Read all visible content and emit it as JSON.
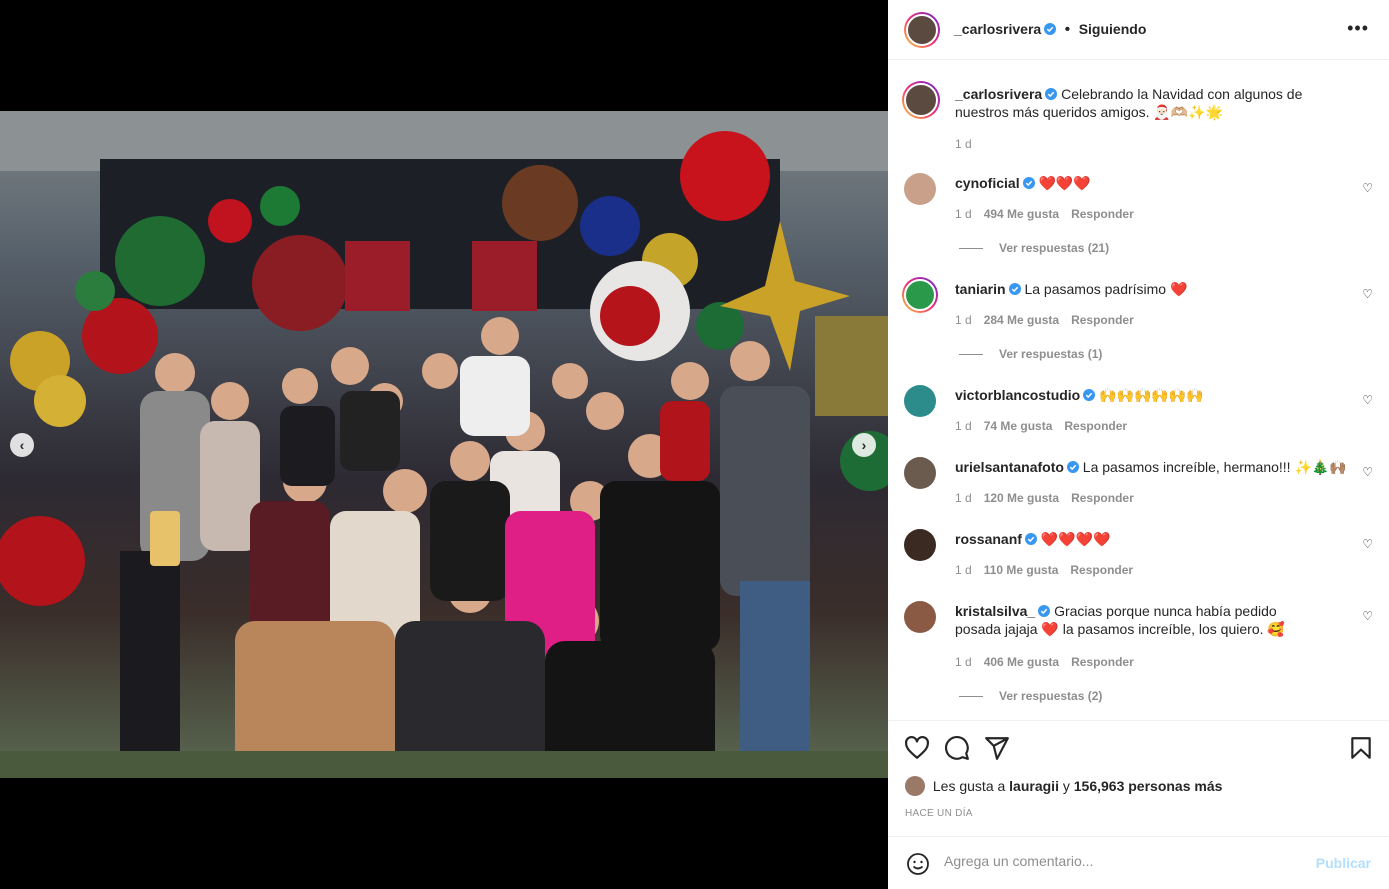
{
  "post": {
    "author": "_carlosrivera",
    "follow_status": "Siguiendo",
    "caption": "Celebrando la Navidad con algunos de nuestros más queridos amigos. 🎅🏻🫶🏼✨🌟",
    "caption_time": "1 d"
  },
  "comments": [
    {
      "user": "cynoficial",
      "text": "❤️❤️❤️",
      "time": "1 d",
      "likes": "494 Me gusta",
      "reply": "Responder",
      "view_replies": "Ver respuestas (21)"
    },
    {
      "user": "taniarin",
      "text": "La pasamos padrísimo ❤️",
      "time": "1 d",
      "likes": "284 Me gusta",
      "reply": "Responder",
      "view_replies": "Ver respuestas (1)"
    },
    {
      "user": "victorblancostudio",
      "text": "🙌🙌🙌🙌🙌🙌",
      "time": "1 d",
      "likes": "74 Me gusta",
      "reply": "Responder"
    },
    {
      "user": "urielsantanafoto",
      "text": "La pasamos increíble, hermano!!! ✨🎄🙌🏽",
      "time": "1 d",
      "likes": "120 Me gusta",
      "reply": "Responder"
    },
    {
      "user": "rossananf",
      "text": "❤️❤️❤️❤️",
      "time": "1 d",
      "likes": "110 Me gusta",
      "reply": "Responder"
    },
    {
      "user": "kristalsilva_",
      "text": "Gracias porque nunca había pedido posada jajaja ❤️ la pasamos increíble, los quiero. 🥰",
      "time": "1 d",
      "likes": "406 Me gusta",
      "reply": "Responder",
      "view_replies": "Ver respuestas (2)"
    }
  ],
  "likes_bar": {
    "prefix": "Les gusta a ",
    "user": "lauragii",
    "middle": " y ",
    "count": "156,963 personas más"
  },
  "post_time": "HACE UN DÍA",
  "add_comment": {
    "placeholder": "Agrega un comentario...",
    "publish": "Publicar"
  },
  "icons": [
    "more-icon",
    "verified-icon",
    "heart-icon",
    "comment-icon",
    "share-icon",
    "bookmark-icon",
    "emoji-icon",
    "chevron-left-icon",
    "chevron-right-icon"
  ],
  "colors": {
    "verified": "#3897f0",
    "link": "#0095f6",
    "publish_disabled": "#b2dffc",
    "heart": "#ed4956"
  }
}
